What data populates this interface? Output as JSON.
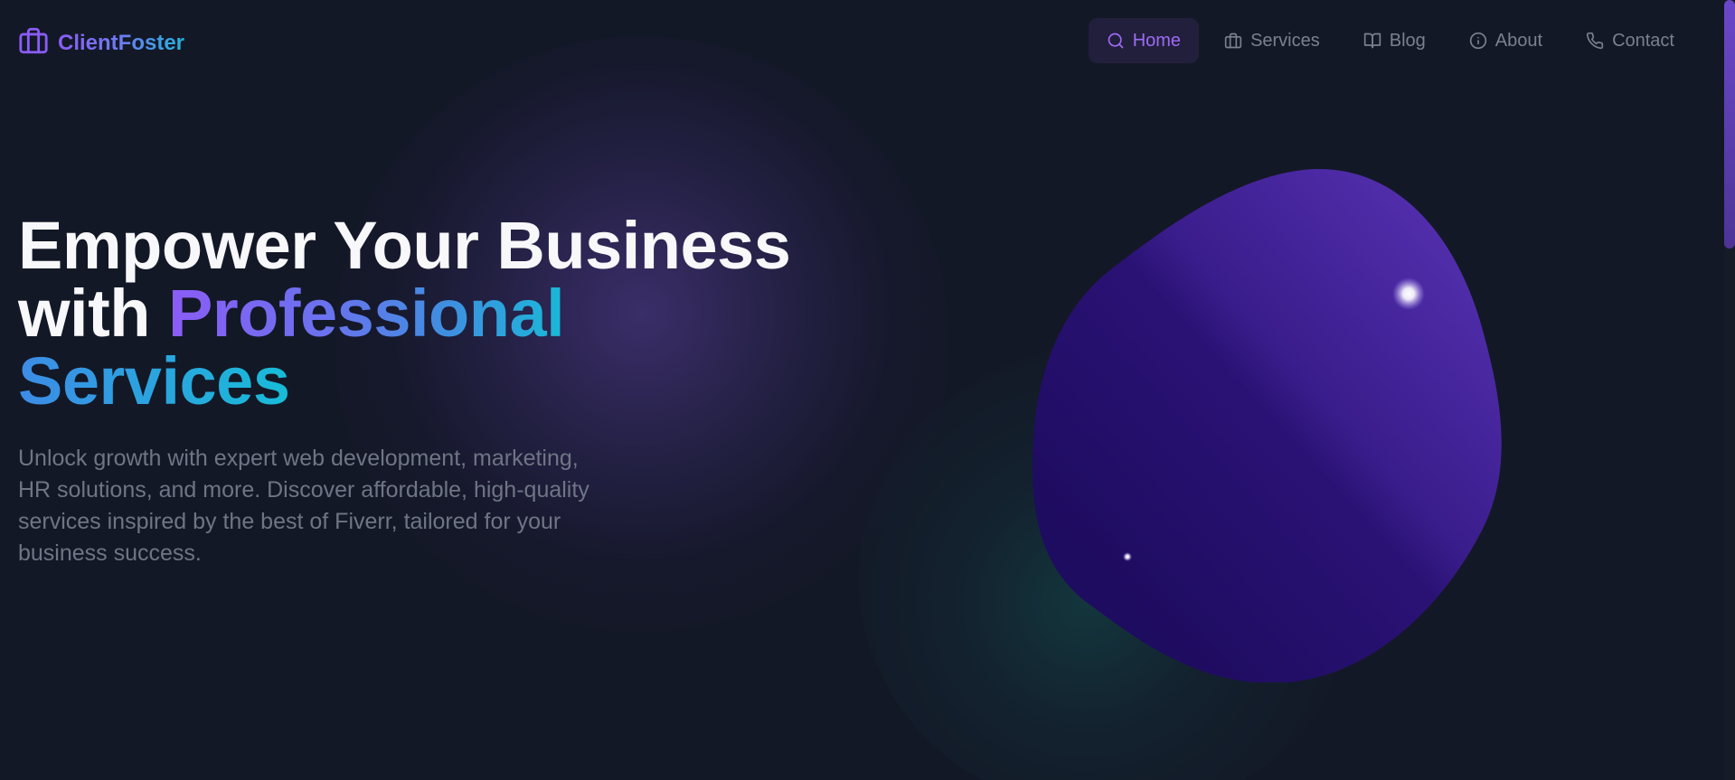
{
  "brand": {
    "name": "ClientFoster",
    "icon": "briefcase-icon"
  },
  "nav": {
    "items": [
      {
        "label": "Home",
        "icon": "search-icon",
        "active": true
      },
      {
        "label": "Services",
        "icon": "briefcase-icon",
        "active": false
      },
      {
        "label": "Blog",
        "icon": "book-open-icon",
        "active": false
      },
      {
        "label": "About",
        "icon": "info-icon",
        "active": false
      },
      {
        "label": "Contact",
        "icon": "phone-icon",
        "active": false
      }
    ]
  },
  "hero": {
    "title_part1": "Empower Your Business",
    "title_part2": "with ",
    "title_highlight": "Professional",
    "title_highlight2": "Services",
    "subtitle": "Unlock growth with expert web development, marketing, HR solutions, and more. Discover affordable, high-quality services inspired by the best of Fiverr, tailored for your business success."
  },
  "colors": {
    "background": "#131826",
    "accent_purple": "#8b5cf6",
    "accent_cyan": "#1ab8d8",
    "nav_active_bg": "#221f3c",
    "blob": "#3d1f8f"
  }
}
